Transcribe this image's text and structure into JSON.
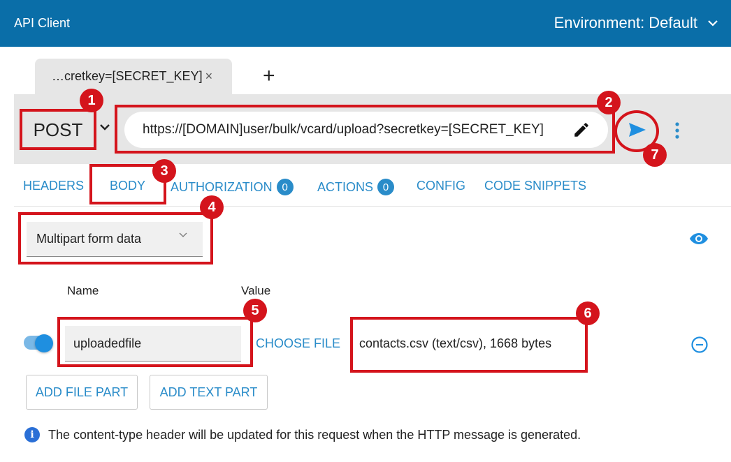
{
  "header": {
    "app_title": "API Client",
    "environment_label": "Environment: Default"
  },
  "tabs": {
    "active_tab_label": "…cretkey=[SECRET_KEY]",
    "close_glyph": "×",
    "add_glyph": "+"
  },
  "request": {
    "method": "POST",
    "url": "https://[DOMAIN]user/bulk/vcard/upload?secretkey=[SECRET_KEY]"
  },
  "subtabs": {
    "headers": "HEADERS",
    "body": "BODY",
    "authorization": "AUTHORIZATION",
    "authorization_count": "0",
    "actions": "ACTIONS",
    "actions_count": "0",
    "config": "CONFIG",
    "code_snippets": "CODE SNIPPETS"
  },
  "body": {
    "type_selected": "Multipart form data",
    "column_name": "Name",
    "column_value": "Value",
    "part": {
      "enabled": true,
      "name": "uploadedfile",
      "choose_label": "CHOOSE FILE",
      "file_info": "contacts.csv (text/csv), 1668 bytes"
    },
    "add_file_part": "ADD FILE PART",
    "add_text_part": "ADD TEXT PART",
    "info_message": "The content-type header will be updated for this request when the HTTP message is generated."
  },
  "annotations": [
    "1",
    "2",
    "3",
    "4",
    "5",
    "6",
    "7"
  ],
  "colors": {
    "header_bg": "#0a6ea8",
    "accent": "#2a8cc9",
    "annotation_red": "#d4141c"
  }
}
